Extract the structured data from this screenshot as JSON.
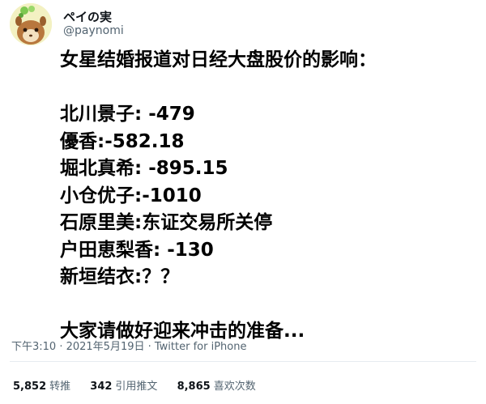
{
  "author": {
    "display_name": "ペイの実",
    "handle": "@paynomi"
  },
  "tweet": {
    "lines": [
      "女星结婚报道对日经大盘股价的影响：",
      "",
      "北川景子: -479",
      "優香:-582.18",
      "堀北真希: -895.15",
      "小仓优子:-1010",
      "石原里美:东证交易所关停",
      "户田恵梨香: -130",
      "新垣结衣:？？",
      "",
      "大家请做好迎来冲击的准备..."
    ],
    "timestamp": "下午3:10 · 2021年5月19日 · Twitter for iPhone"
  },
  "stats": {
    "retweets_count": "5,852",
    "retweets_label": "转推",
    "quotes_count": "342",
    "quotes_label": "引用推文",
    "likes_count": "8,865",
    "likes_label": "喜欢次数"
  }
}
